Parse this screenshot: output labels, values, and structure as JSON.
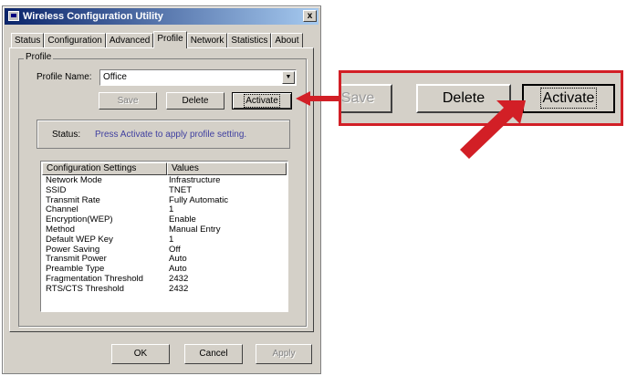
{
  "window": {
    "title": "Wireless Configuration Utility",
    "close_glyph": "x"
  },
  "tabs": [
    {
      "label": "Status"
    },
    {
      "label": "Configuration"
    },
    {
      "label": "Advanced"
    },
    {
      "label": "Profile",
      "active": true
    },
    {
      "label": "Network"
    },
    {
      "label": "Statistics"
    },
    {
      "label": "About"
    }
  ],
  "profile": {
    "group_label": "Profile",
    "name_label": "Profile Name:",
    "name_value": "Office",
    "save_label": "Save",
    "delete_label": "Delete",
    "activate_label": "Activate",
    "status_label": "Status:",
    "status_text": "Press Activate to apply profile setting."
  },
  "table": {
    "headers": [
      "Configuration Settings",
      "Values"
    ],
    "rows": [
      [
        "Network Mode",
        "Infrastructure"
      ],
      [
        "SSID",
        "TNET"
      ],
      [
        "Transmit Rate",
        "Fully Automatic"
      ],
      [
        "Channel",
        "1"
      ],
      [
        "Encryption(WEP)",
        "Enable"
      ],
      [
        "Method",
        "Manual Entry"
      ],
      [
        "Default WEP Key",
        "1"
      ],
      [
        "Power Saving",
        "Off"
      ],
      [
        "Transmit Power",
        "Auto"
      ],
      [
        "Preamble Type",
        "Auto"
      ],
      [
        "Fragmentation Threshold",
        "2432"
      ],
      [
        "RTS/CTS Threshold",
        "2432"
      ]
    ]
  },
  "footer": {
    "ok_label": "OK",
    "cancel_label": "Cancel",
    "apply_label": "Apply"
  },
  "callout": {
    "save_label": "Save",
    "delete_label": "Delete",
    "activate_label": "Activate",
    "accent_color": "#d21f26"
  }
}
